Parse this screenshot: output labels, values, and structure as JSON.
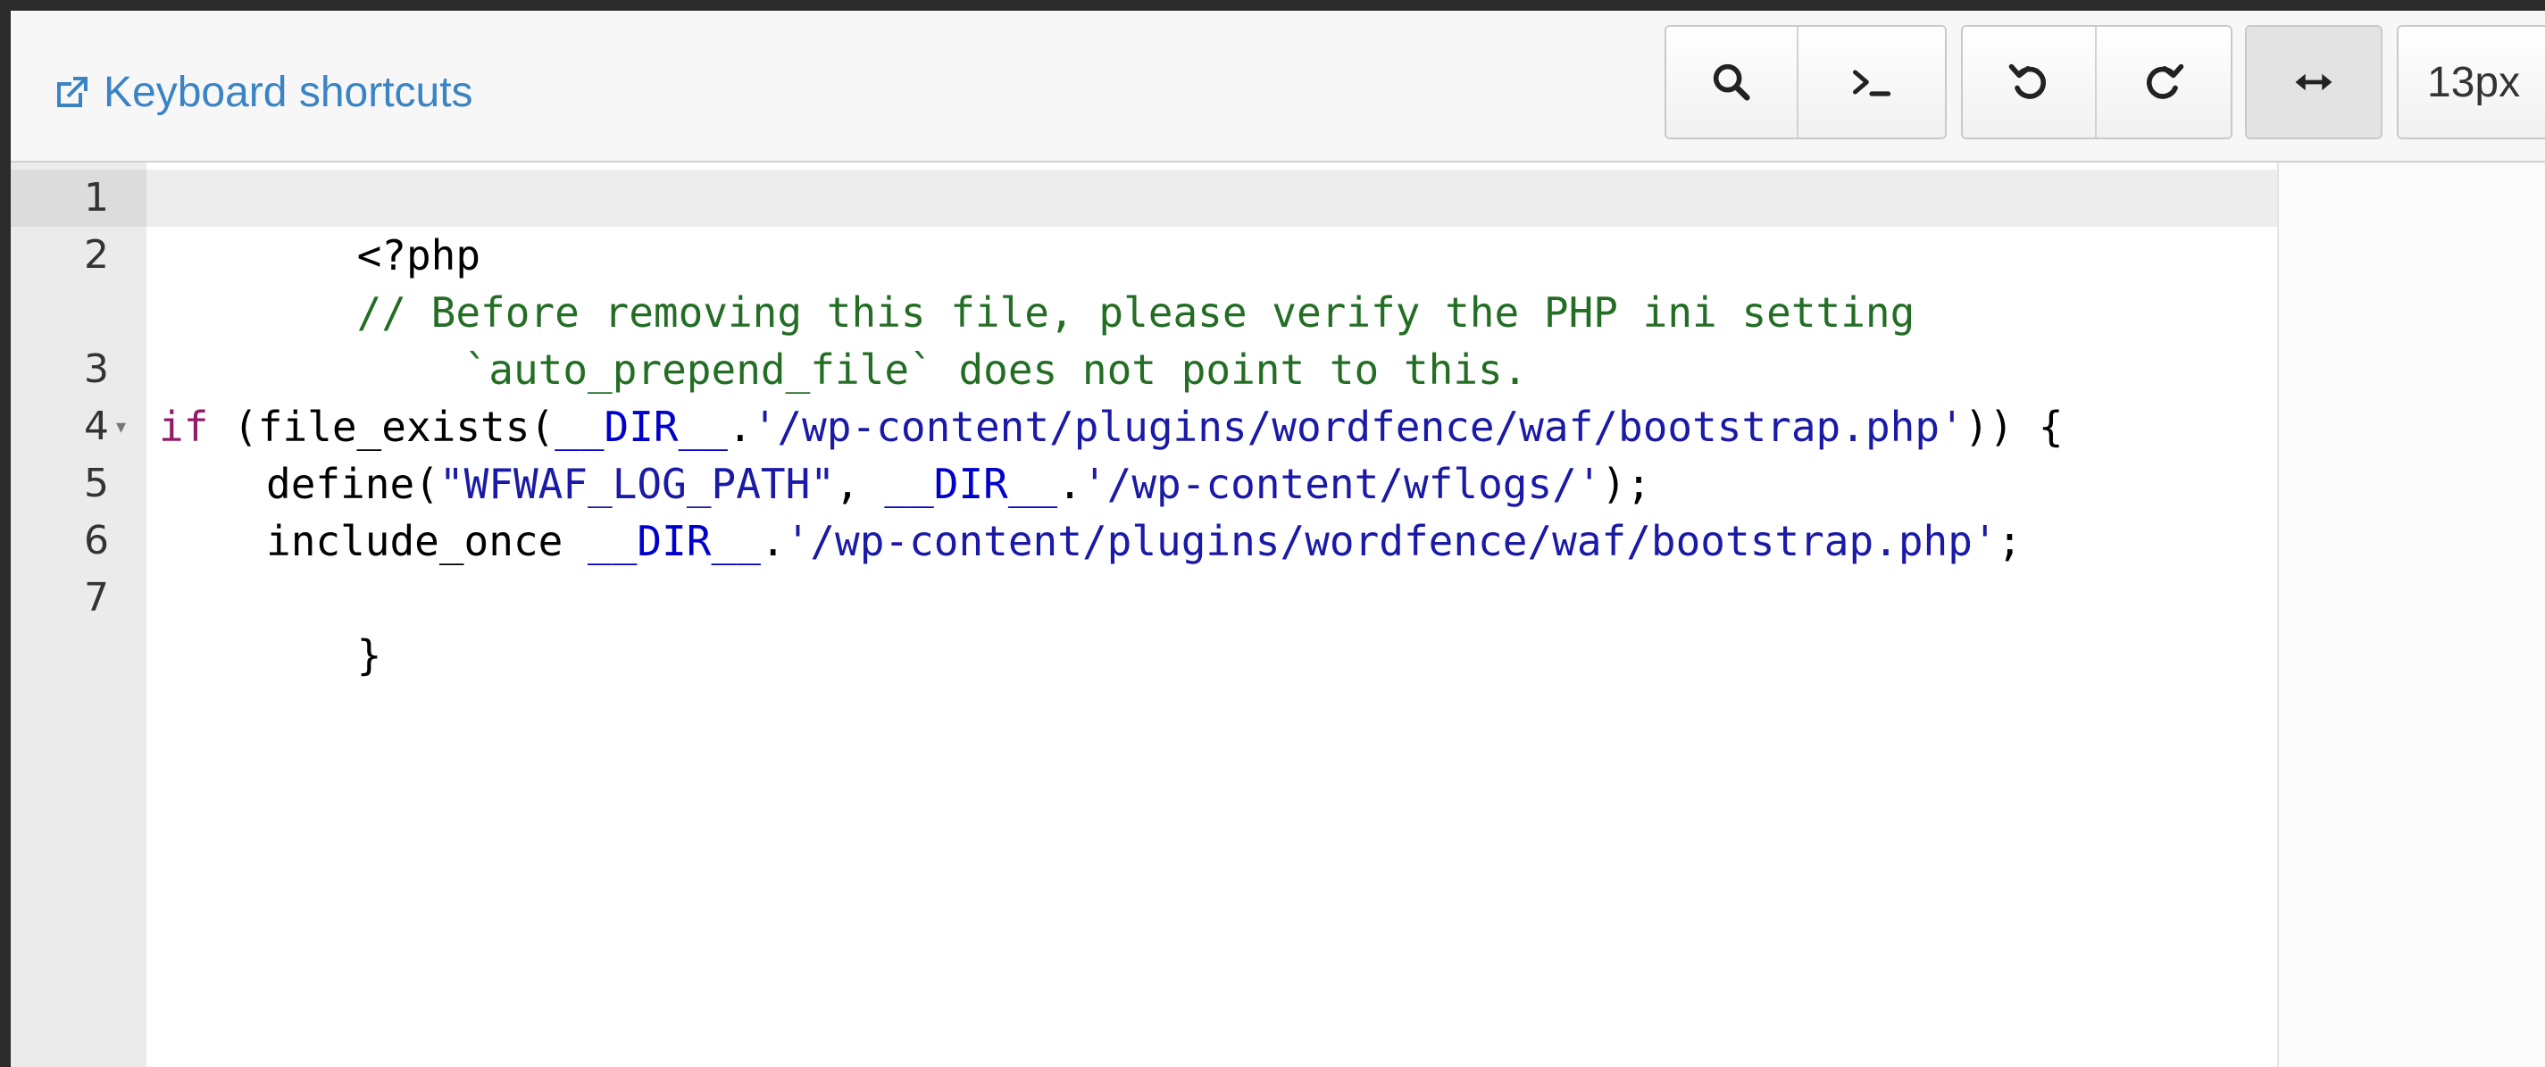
{
  "toolbar": {
    "keyboard_shortcuts_label": "Keyboard shortcuts",
    "font_size_label": "13px",
    "buttons": {
      "search": "search-icon",
      "terminal": "terminal-icon",
      "undo": "undo-icon",
      "redo": "redo-icon",
      "wrap": "horizontal-arrows-icon"
    }
  },
  "editor": {
    "line_numbers": [
      "1",
      "2",
      "3",
      "4",
      "5",
      "6",
      "7"
    ],
    "lines": {
      "l1": {
        "php": "<?php"
      },
      "l2a": {
        "comment": "// Before removing this file, please verify the PHP ini setting"
      },
      "l2b": {
        "comment": "`auto_prepend_file` does not point to this."
      },
      "l4": {
        "kw": "if",
        "p1": " (file_exists(",
        "const": "__DIR__",
        "p2": ".",
        "str": "'/wp-content/plugins/wordfence/waf/bootstrap.php'",
        "p3": ")) {"
      },
      "l5": {
        "fn": "define(",
        "str1": "\"WFWAF_LOG_PATH\"",
        "p1": ", ",
        "const": "__DIR__",
        "p2": ".",
        "str2": "'/wp-content/wflogs/'",
        "p3": ");"
      },
      "l6": {
        "fn": "include_once ",
        "const": "__DIR__",
        "p2": ".",
        "str": "'/wp-content/plugins/wordfence/waf/bootstrap.php'",
        "p3": ";"
      },
      "l7": {
        "p": "}"
      }
    },
    "colors": {
      "comment": "#236e24",
      "keyword": "#931a68",
      "constant": "#0000cd",
      "string": "#1a1aa6",
      "link": "#3a84c4"
    }
  }
}
